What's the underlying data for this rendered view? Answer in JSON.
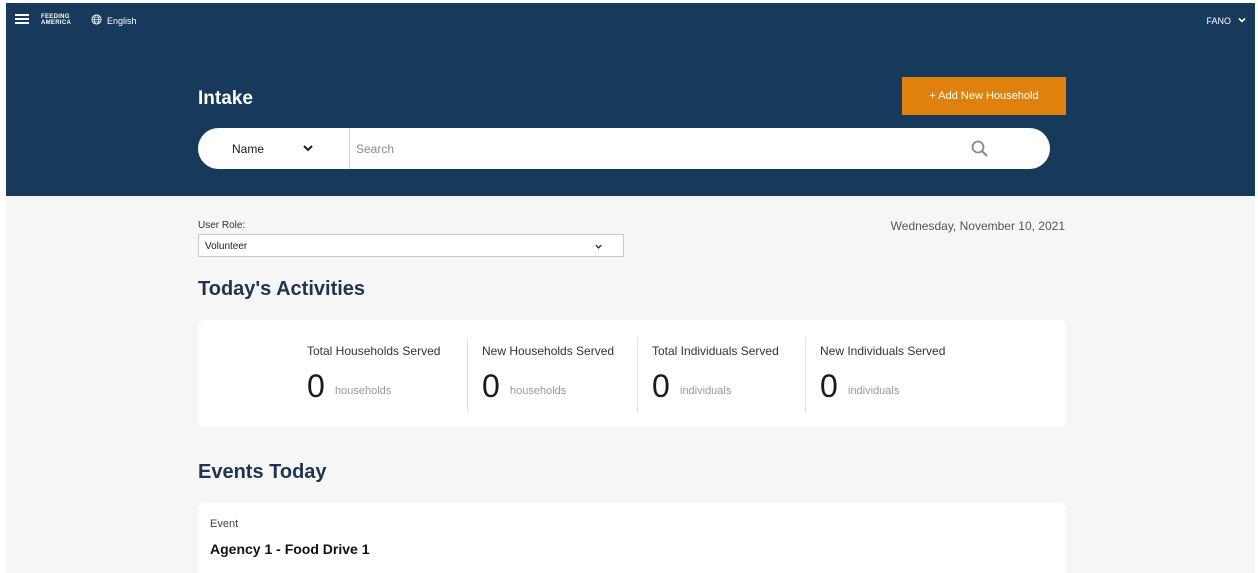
{
  "topbar": {
    "logo_line1": "FEEDING",
    "logo_line2": "AMERICA",
    "language": "English",
    "user": "FANO"
  },
  "header": {
    "title": "Intake",
    "add_button": "+ Add New Household",
    "search": {
      "type_label": "Name",
      "placeholder": "Search"
    }
  },
  "role": {
    "label": "User Role:",
    "value": "Volunteer"
  },
  "date": "Wednesday, November 10, 2021",
  "activities": {
    "title": "Today's Activities",
    "stats": [
      {
        "label": "Total Households Served",
        "value": "0",
        "unit": "households"
      },
      {
        "label": "New Households Served",
        "value": "0",
        "unit": "households"
      },
      {
        "label": "Total Individuals Served",
        "value": "0",
        "unit": "individuals"
      },
      {
        "label": "New Individuals Served",
        "value": "0",
        "unit": "individuals"
      }
    ]
  },
  "events": {
    "title": "Events Today",
    "items": [
      {
        "label": "Event",
        "name": "Agency 1 - Food Drive 1"
      }
    ]
  },
  "colors": {
    "header_bg": "#173a5c",
    "accent": "#e0810e",
    "page_bg": "#f6f6f6"
  }
}
